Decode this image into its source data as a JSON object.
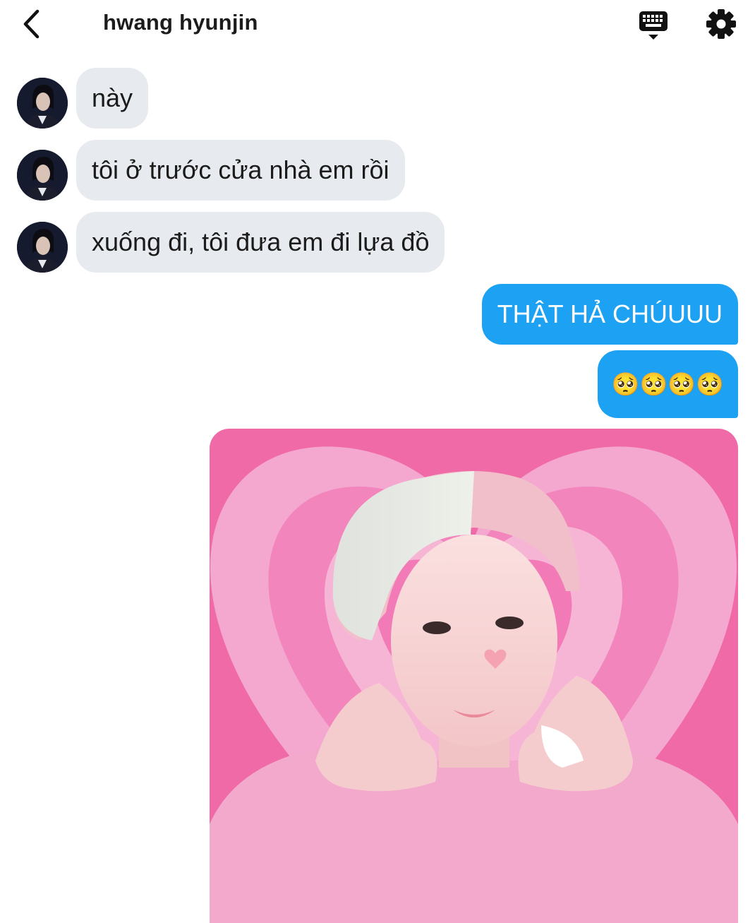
{
  "header": {
    "title": "hwang hyunjin",
    "back_icon": "chevron-left-icon",
    "keyboard_icon": "keyboard-icon",
    "settings_icon": "gear-icon"
  },
  "messages": [
    {
      "direction": "incoming",
      "text": "này"
    },
    {
      "direction": "incoming",
      "text": "tôi ở trước cửa nhà em rồi"
    },
    {
      "direction": "incoming",
      "text": "xuống đi, tôi đưa em đi lựa đồ"
    },
    {
      "direction": "outgoing",
      "text": "THẬT HẢ CHÚUUU"
    },
    {
      "direction": "outgoing",
      "text": "🥺🥺🥺🥺"
    },
    {
      "direction": "outgoing",
      "type": "image",
      "image_subject": "person-photo-pink-heart-background"
    }
  ],
  "colors": {
    "outgoing_bubble": "#1da1f2",
    "incoming_bubble": "#e7eaee",
    "photo_background": "#f06aa8"
  }
}
